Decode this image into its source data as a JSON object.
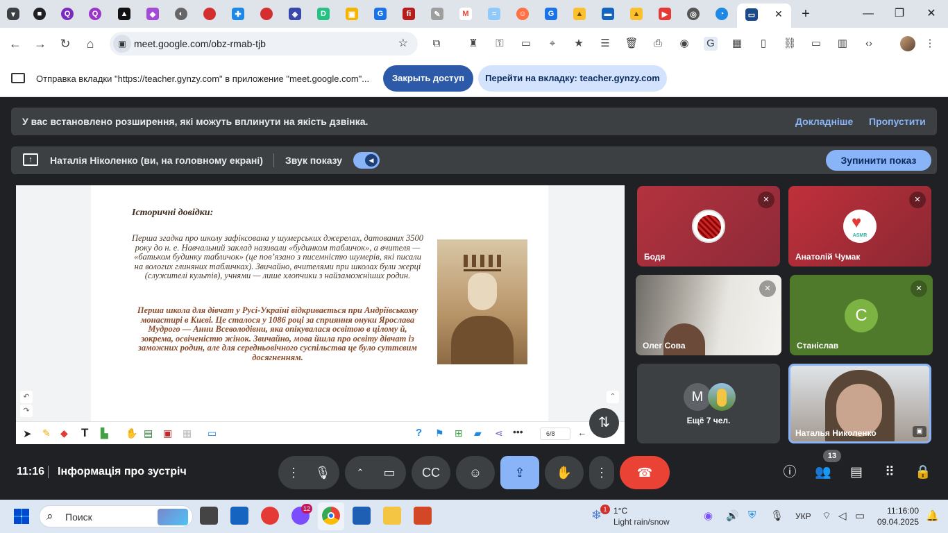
{
  "browser": {
    "url": "meet.google.com/obz-rmab-tjb",
    "tab_close": "✕",
    "new_tab": "+"
  },
  "infobar": {
    "text": "Отправка вкладки \"https://teacher.gynzy.com\" в приложение \"meet.google.com\"...",
    "stop_button": "Закрыть доступ",
    "switch_button": "Перейти на вкладку: teacher.gynzy.com"
  },
  "meet": {
    "ext_banner": {
      "text": "У вас встановлено розширення, які можуть вплинути на якість дзвінка.",
      "learn_more": "Докладніше",
      "skip": "Пропустити"
    },
    "presenting": {
      "title": "Наталія Ніколенко (ви, на головному екрані)",
      "sound_label": "Звук показу",
      "stop_button": "Зупинити показ"
    },
    "slide": {
      "heading": "Історичні довідки:",
      "para1": "Перша згадка про школу зафіксована у шумерських джерелах, датованих 3500 року до н. е. Навчальний заклад називали «будинком табличок», а вчителя — «батьком будинку табличок» (це пов’язано з писемністю шумерів, які писали на вологих глиняних табличках). Звичайно, вчителями при школах були жерці (служителі культів), учнями — лише хлопчики з найзаможніших родин.",
      "para2": "Перша школа для дівчат у Русі-Україні відкривається при Андріївському монастирі в Києві. Це сталося у 1086 році за сприяння онуки Ярослава Мудрого — Анни Всеволодівни, яка опікувалася освітою в цілому й, зокрема, освіченістю жінок. Звичайно, мова йшла про освіту дівчат із заможних родин, але для середньовічного суспільства це було суттєвим досягненням.",
      "page": "6/8"
    },
    "participants": [
      {
        "name": "Бодя"
      },
      {
        "name": "Анатолій Чумак",
        "avatar_text": "ASMR"
      },
      {
        "name": "Олег Сова"
      },
      {
        "name": "Станіслав",
        "initial": "C"
      },
      {
        "name": "Ещё 7 чел.",
        "initial": "M"
      },
      {
        "name": "Наталья Николенко"
      }
    ],
    "bottom": {
      "time": "11:16",
      "meeting_info": "Інформація про зустріч",
      "people_count": "13"
    }
  },
  "taskbar": {
    "search_placeholder": "Поиск",
    "weather_temp": "1°C",
    "weather_desc": "Light rain/snow",
    "weather_badge": "1",
    "viber_badge": "12",
    "lang": "УКР",
    "clock_time": "11:16:00",
    "clock_date": "09.04.2025"
  },
  "colors": {
    "meet_bg": "#202124",
    "accent_blue": "#8ab4f8",
    "end_call_red": "#ea4335"
  }
}
